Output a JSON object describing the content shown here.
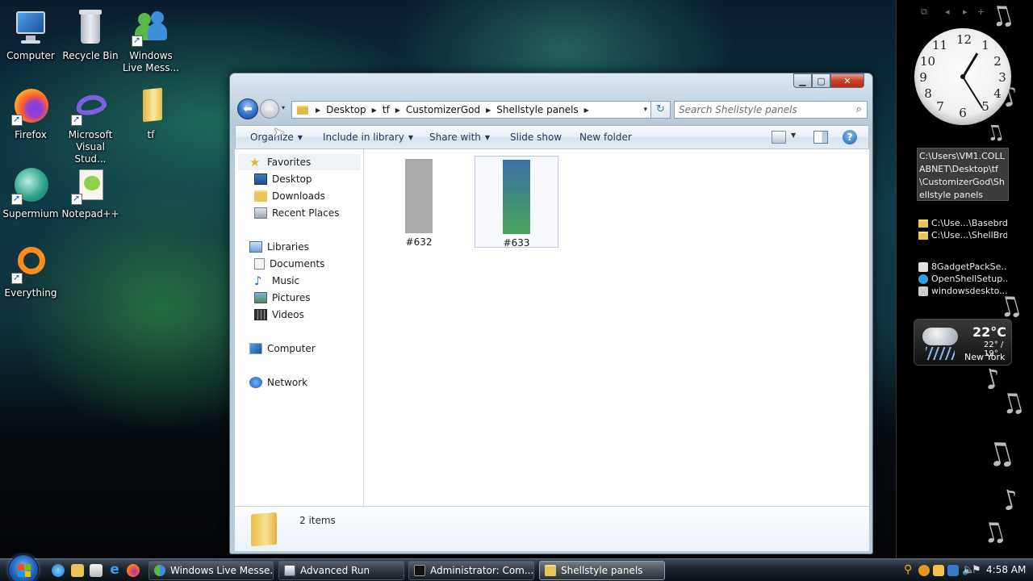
{
  "desktop": {
    "icons": [
      {
        "label": "Computer"
      },
      {
        "label": "Recycle Bin"
      },
      {
        "label": "Windows Live Mess..."
      },
      {
        "label": "Firefox"
      },
      {
        "label": "Microsoft Visual Stud..."
      },
      {
        "label": "tf"
      },
      {
        "label": "Supermium"
      },
      {
        "label": "Notepad++"
      },
      {
        "label": "Everything"
      }
    ]
  },
  "window": {
    "address": {
      "segments": [
        "Desktop",
        "tf",
        "CustomizerGod",
        "Shellstyle panels"
      ]
    },
    "search": {
      "placeholder": "Search Shellstyle panels"
    },
    "commands": {
      "organize": "Organize",
      "include_in_library": "Include in library",
      "share_with": "Share with",
      "slide_show": "Slide show",
      "new_folder": "New folder"
    },
    "nav": {
      "favorites": "Favorites",
      "desktop": "Desktop",
      "downloads": "Downloads",
      "recent_places": "Recent Places",
      "libraries": "Libraries",
      "documents": "Documents",
      "music": "Music",
      "pictures": "Pictures",
      "videos": "Videos",
      "computer": "Computer",
      "network": "Network"
    },
    "files": [
      {
        "name": "#632",
        "color": "#a9a9a9"
      },
      {
        "name": "#633",
        "color_top": "#3a6fa8",
        "color_bottom": "#4aa55a"
      }
    ],
    "details": {
      "count": "2 items"
    }
  },
  "gadgets": {
    "path_text": "C:\\Users\\VM1.COLLABNET\\Desktop\\tf\\CustomizerGod\\Shellstyle panels",
    "folders": [
      "C:\\Use...\\Basebrd",
      "C:\\Use...\\ShellBrd"
    ],
    "apps": [
      "8GadgetPackSe...",
      "OpenShellSetup...",
      "windowsdeskto..."
    ],
    "weather": {
      "temp": "22°C",
      "range": "22° / 19°",
      "city": "New York"
    }
  },
  "taskbar": {
    "tasks": [
      {
        "label": "Windows Live Messe..."
      },
      {
        "label": "Advanced Run"
      },
      {
        "label": "Administrator: Com..."
      },
      {
        "label": "Shellstyle panels"
      }
    ],
    "time": "4:58 AM"
  },
  "colors": {
    "accent": "#1f5fb7",
    "close_button": "#c8432c"
  }
}
